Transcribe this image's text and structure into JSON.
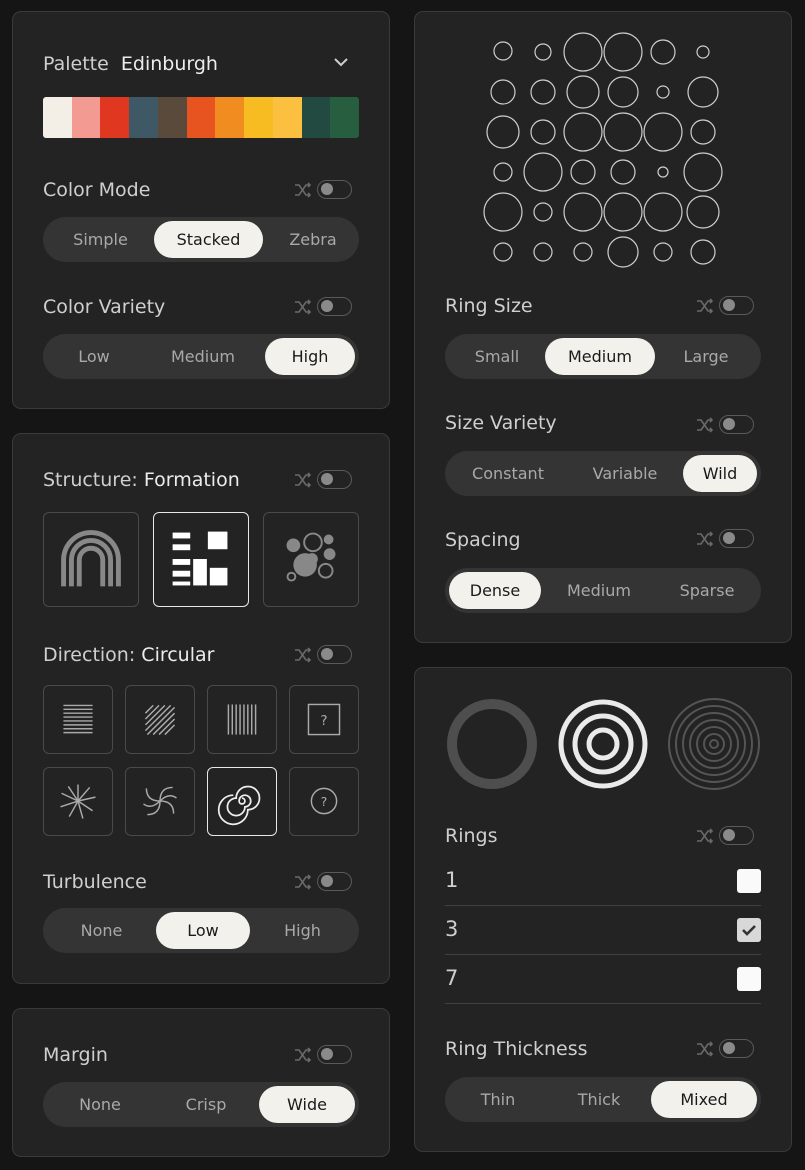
{
  "palette": {
    "label": "Palette",
    "value": "Edinburgh",
    "colors": [
      "#f3efe6",
      "#f39a92",
      "#e03820",
      "#3e5866",
      "#5a4a3c",
      "#e85420",
      "#f08c20",
      "#f6bc22",
      "#fcc040",
      "#234a40",
      "#285e40"
    ]
  },
  "color_mode": {
    "label": "Color Mode",
    "options": [
      "Simple",
      "Stacked",
      "Zebra"
    ],
    "selected": "Stacked"
  },
  "color_variety": {
    "label": "Color Variety",
    "options": [
      "Low",
      "Medium",
      "High"
    ],
    "selected": "High"
  },
  "structure": {
    "label": "Structure:",
    "value": "Formation",
    "tiles": [
      "arch",
      "formation",
      "bubbles"
    ],
    "selected": "formation"
  },
  "direction": {
    "label": "Direction:",
    "value": "Circular",
    "tiles": [
      "horizontal",
      "diagonal",
      "vertical",
      "random-square",
      "radial",
      "swirl",
      "circular",
      "random-circle"
    ],
    "selected": "circular",
    "random_symbol": "?"
  },
  "turbulence": {
    "label": "Turbulence",
    "options": [
      "None",
      "Low",
      "High"
    ],
    "selected": "Low"
  },
  "margin": {
    "label": "Margin",
    "options": [
      "None",
      "Crisp",
      "Wide"
    ],
    "selected": "Wide"
  },
  "ring_size": {
    "label": "Ring Size",
    "options": [
      "Small",
      "Medium",
      "Large"
    ],
    "selected": "Medium"
  },
  "size_variety": {
    "label": "Size Variety",
    "options": [
      "Constant",
      "Variable",
      "Wild"
    ],
    "selected": "Wild"
  },
  "spacing": {
    "label": "Spacing",
    "options": [
      "Dense",
      "Medium",
      "Sparse"
    ],
    "selected": "Dense"
  },
  "rings": {
    "label": "Rings",
    "previews": [
      "single-ring",
      "three-rings",
      "seven-rings"
    ],
    "options": [
      {
        "value": "1",
        "checked": false
      },
      {
        "value": "3",
        "checked": true
      },
      {
        "value": "7",
        "checked": false
      }
    ]
  },
  "ring_thickness": {
    "label": "Ring Thickness",
    "options": [
      "Thin",
      "Thick",
      "Mixed"
    ],
    "selected": "Mixed"
  },
  "colors": {
    "accent": "#f3f1ec",
    "panel": "#232323",
    "background": "#151515"
  }
}
